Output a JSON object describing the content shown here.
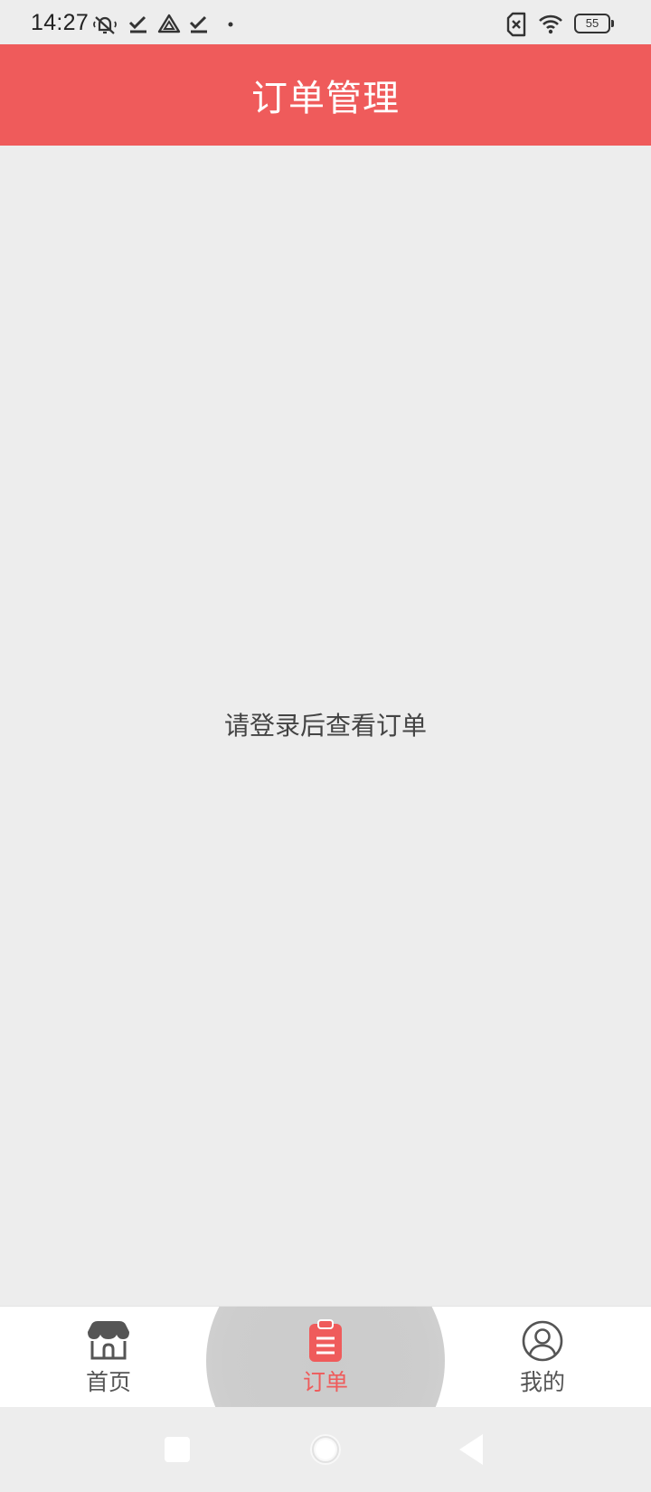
{
  "status_bar": {
    "time": "14:27",
    "battery_level": "55",
    "icons": [
      "notifications-off-icon",
      "check-icon",
      "drive-icon",
      "check-icon",
      "dot-icon",
      "no-sim-icon",
      "wifi-icon",
      "battery-icon"
    ]
  },
  "header": {
    "title": "订单管理",
    "background_color": "#ef5b5b"
  },
  "main": {
    "empty_message": "请登录后查看订单"
  },
  "bottom_nav": {
    "items": [
      {
        "label": "首页",
        "icon": "shop-icon",
        "active": false
      },
      {
        "label": "订单",
        "icon": "clipboard-icon",
        "active": true
      },
      {
        "label": "我的",
        "icon": "user-icon",
        "active": false
      }
    ],
    "active_color": "#ef5b5b",
    "inactive_color": "#555555"
  },
  "system_nav": {
    "buttons": [
      "recents-button",
      "home-button",
      "back-button"
    ]
  }
}
